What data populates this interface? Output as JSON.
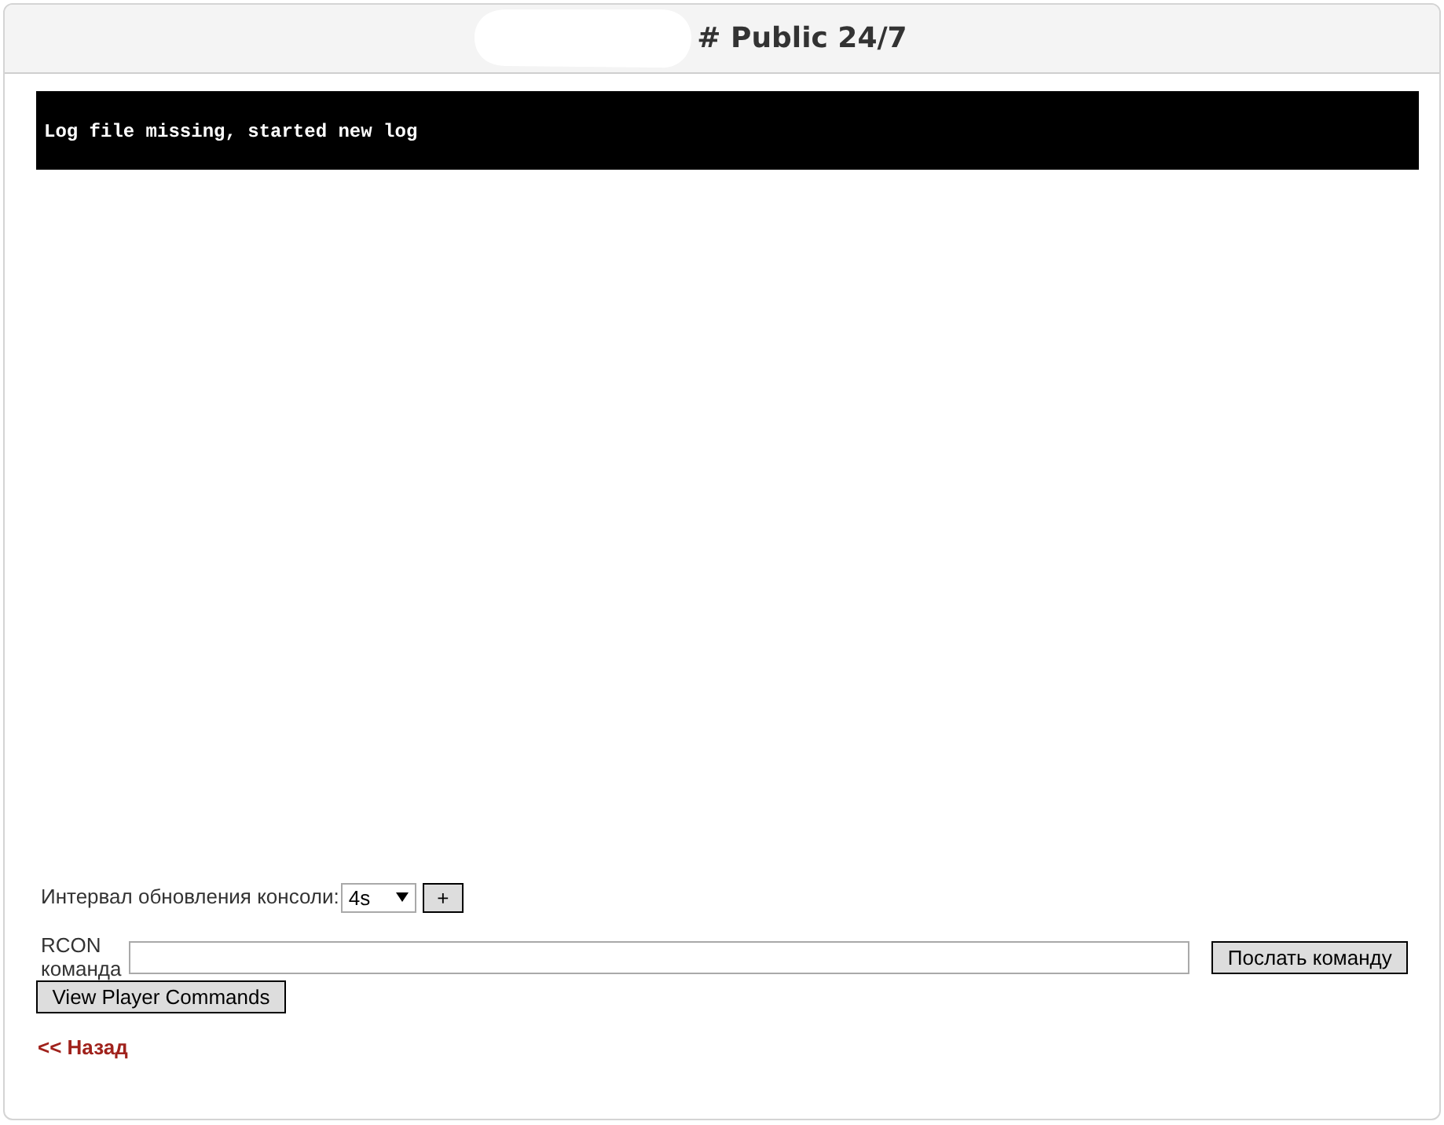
{
  "header": {
    "title": "# Public 24/7",
    "redacted": true
  },
  "console": {
    "lines": [
      "Log file missing, started new log"
    ]
  },
  "refresh": {
    "label": "Интервал обновления консоли:",
    "interval": "4s",
    "add_button": "+"
  },
  "rcon": {
    "label": "RCON команда",
    "send_button": "Послать команду"
  },
  "view_commands_button": "View Player Commands",
  "back_link": "<< Назад"
}
